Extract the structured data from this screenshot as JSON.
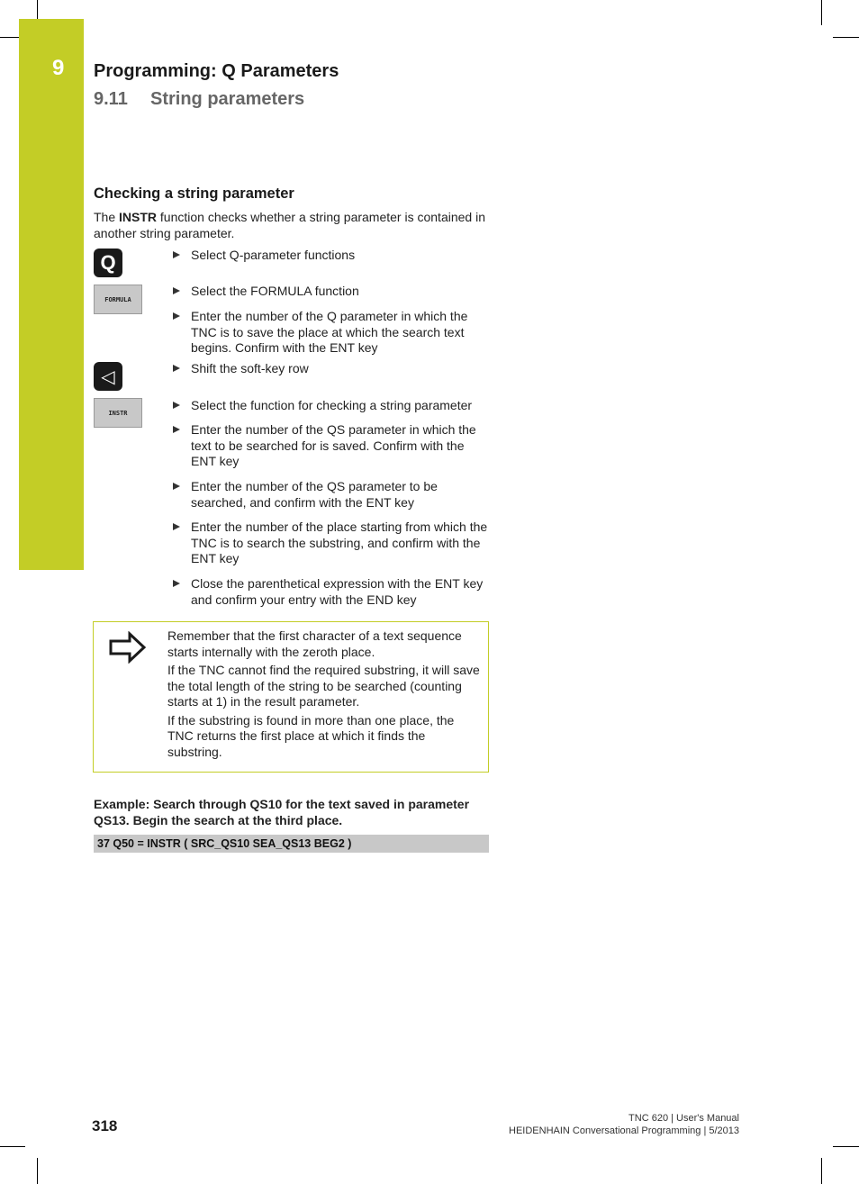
{
  "header": {
    "chapter_number": "9",
    "chapter_title": "Programming: Q Parameters",
    "section_number": "9.11",
    "section_title": "String parameters",
    "tab_color": "#c3cd26"
  },
  "content": {
    "heading": "Checking a string parameter",
    "intro_prefix": "The ",
    "intro_bold": "INSTR",
    "intro_suffix": " function checks whether a string parameter is contained in another string parameter.",
    "keys": [
      {
        "type": "hardkey",
        "label": "Q",
        "icon": "q-key-icon"
      },
      {
        "type": "softkey",
        "label": "FORMULA",
        "icon": "formula-softkey"
      },
      {
        "type": "hardkey",
        "label": "◁",
        "icon": "shift-softkey-row-icon"
      },
      {
        "type": "softkey",
        "label": "INSTR",
        "icon": "instr-softkey"
      }
    ],
    "steps": [
      "Select Q-parameter functions",
      "Select the FORMULA function",
      "Enter the number of the Q parameter in which the TNC is to save the place at which the search text begins. Confirm with the ENT key",
      "Shift the soft-key row",
      "Select the function for checking a string parameter",
      "Enter the number of the QS parameter in which the text to be searched for is saved. Confirm with the ENT key",
      "Enter the number of the QS parameter to be searched, and confirm with the ENT key",
      "Enter the number of the place starting from which the TNC is to search the substring, and confirm with the ENT key",
      "Close the parenthetical expression with the ENT key and confirm your entry with the END key"
    ],
    "note": {
      "icon": "arrow-right-icon",
      "paragraphs": [
        "Remember that the first character of a text sequence starts internally with the zeroth place.",
        "If the TNC cannot find the required substring, it will save the total length of the string to be searched (counting starts at 1) in the result parameter.",
        "If the substring is found in more than one place, the TNC returns the first place at which it finds the substring."
      ]
    },
    "example_heading": "Example: Search through QS10 for the text saved in parameter QS13. Begin the search at the third place.",
    "example_code": "37 Q50 = INSTR ( SRC_QS10 SEA_QS13 BEG2 )"
  },
  "footer": {
    "page_number": "318",
    "line1": "TNC 620 | User's Manual",
    "line2": "HEIDENHAIN Conversational Programming | 5/2013"
  }
}
